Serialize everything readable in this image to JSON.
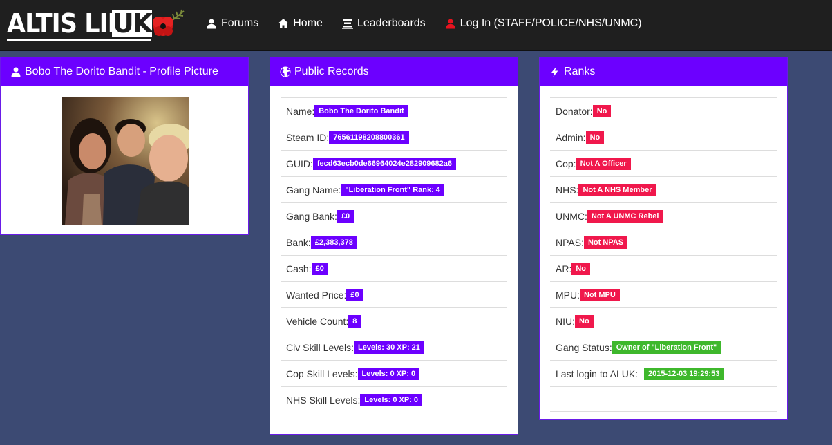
{
  "brand": {
    "logo_text": "ALTIS LIFE",
    "logo_uk": "UK"
  },
  "nav": {
    "items": [
      {
        "label": "Forums",
        "icon": "user-icon"
      },
      {
        "label": "Home",
        "icon": "home-icon"
      },
      {
        "label": "Leaderboards",
        "icon": "list-icon"
      },
      {
        "label": "Log In (STAFF/POLICE/NHS/UNMC)",
        "icon": "user-icon",
        "icon_color": "#e8131f"
      }
    ]
  },
  "profile": {
    "title": "Bobo The Dorito Bandit - Profile Picture",
    "icon": "user-icon"
  },
  "records": {
    "title": "Public Records",
    "icon": "globe-icon",
    "rows": [
      {
        "label": "Name:",
        "value": "Bobo The Dorito Bandit"
      },
      {
        "label": "Steam ID:",
        "value": "76561198208800361"
      },
      {
        "label": "GUID:",
        "value": "fecd63ecb0de66964024e282909682a6"
      },
      {
        "label": "Gang Name:",
        "value": "\"Liberation Front\" Rank: 4"
      },
      {
        "label": "Gang Bank:",
        "value": "£0"
      },
      {
        "label": "Bank:",
        "value": "£2,383,378"
      },
      {
        "label": "Cash:",
        "value": "£0"
      },
      {
        "label": "Wanted Price:",
        "value": "£0"
      },
      {
        "label": "Vehicle Count:",
        "value": "8"
      },
      {
        "label": "Civ Skill Levels:",
        "value": "Levels: 30 XP: 21"
      },
      {
        "label": "Cop Skill Levels:",
        "value": "Levels: 0 XP: 0"
      },
      {
        "label": "NHS Skill Levels:",
        "value": "Levels: 0 XP: 0"
      }
    ]
  },
  "ranks": {
    "title": "Ranks",
    "icon": "bolt-icon",
    "rows": [
      {
        "label": "Donator:",
        "value": "No",
        "color": "red"
      },
      {
        "label": "Admin:",
        "value": "No",
        "color": "red"
      },
      {
        "label": "Cop:",
        "value": "Not A Officer",
        "color": "red"
      },
      {
        "label": "NHS:",
        "value": "Not A NHS Member",
        "color": "red"
      },
      {
        "label": "UNMC:",
        "value": "Not A UNMC Rebel",
        "color": "red"
      },
      {
        "label": "NPAS:",
        "value": "Not NPAS",
        "color": "red"
      },
      {
        "label": "AR:",
        "value": "No",
        "color": "red"
      },
      {
        "label": "MPU:",
        "value": "Not MPU",
        "color": "red"
      },
      {
        "label": "NIU:",
        "value": "No",
        "color": "red"
      },
      {
        "label": "Gang Status:",
        "value": "Owner of \"Liberation Front\"",
        "color": "green"
      },
      {
        "label": "Last login to ALUK: ",
        "value": "2015-12-03 19:29:53",
        "color": "green"
      }
    ]
  },
  "colors": {
    "panel_header": "#6c00ff",
    "badge_purple": "#6c00ff",
    "badge_red": "#f0184c",
    "badge_green": "#3eb82c",
    "background": "#3c4a73",
    "navbar": "#1f1f1f"
  }
}
